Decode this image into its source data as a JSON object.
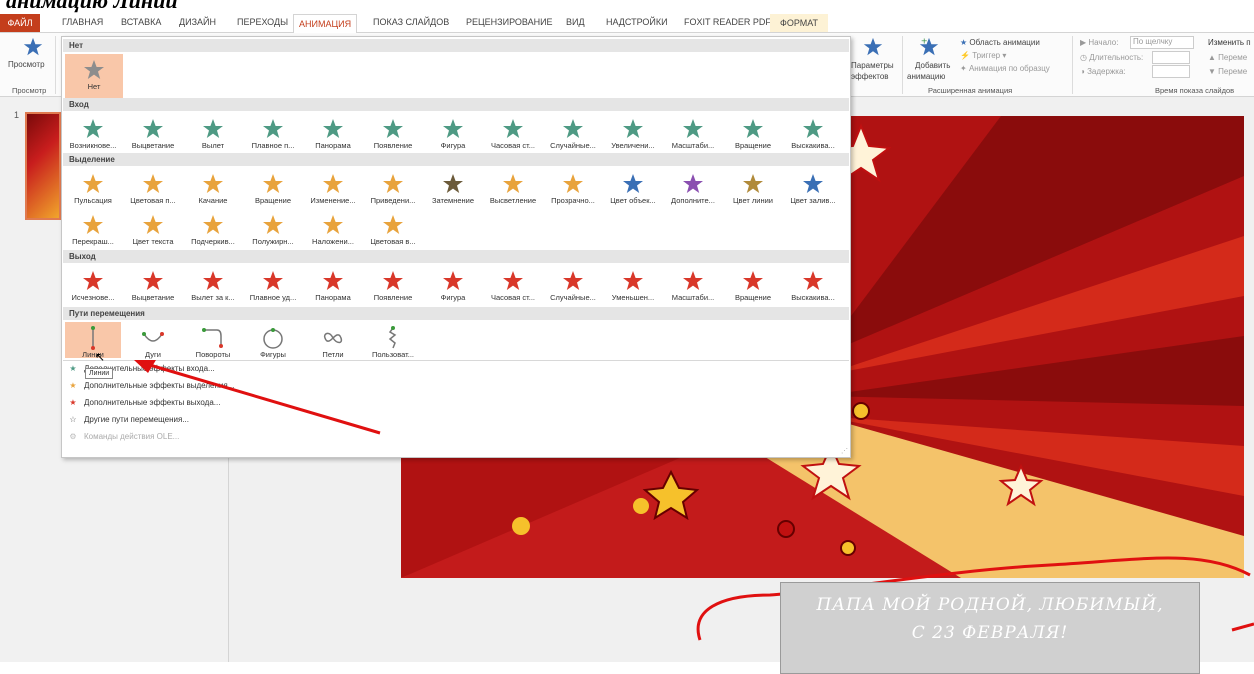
{
  "header_title": "анимацию Линии",
  "tabs": [
    "ФАЙЛ",
    "ГЛАВНАЯ",
    "ВСТАВКА",
    "ДИЗАЙН",
    "ПЕРЕХОДЫ",
    "АНИМАЦИЯ",
    "ПОКАЗ СЛАЙДОВ",
    "РЕЦЕНЗИРОВАНИЕ",
    "ВИД",
    "НАДСТРОЙКИ",
    "FOXIT READER PDF",
    "ФОРМАТ"
  ],
  "ribbon": {
    "preview_label": "Просмотр",
    "preview_group": "Просмотр",
    "effect_params": "Параметры",
    "effect_params2": "эффектов",
    "add_anim": "Добавить",
    "add_anim2": "анимацию",
    "anim_pane": "Область анимации",
    "trigger": "Триггер",
    "anim_painter": "Анимация по образцу",
    "adv_group": "Расширенная анимация",
    "start_label": "Начало:",
    "start_value": "По щелчку",
    "duration_label": "Длительность:",
    "delay_label": "Задержка:",
    "reorder": "Изменить п",
    "move_earlier": "Переме",
    "move_later": "Переме",
    "timing_group": "Время показа слайдов"
  },
  "gallery": {
    "none_header": "Нет",
    "none_item": "Нет",
    "entrance_header": "Вход",
    "entrance": [
      "Возникнове...",
      "Выцветание",
      "Вылет",
      "Плавное п...",
      "Панорама",
      "Появление",
      "Фигура",
      "Часовая ст...",
      "Случайные...",
      "Увеличени...",
      "Масштаби...",
      "Вращение",
      "Выскакива..."
    ],
    "emphasis_header": "Выделение",
    "emphasis1": [
      "Пульсация",
      "Цветовая п...",
      "Качание",
      "Вращение",
      "Изменение...",
      "Приведени...",
      "Затемнение",
      "Высветление",
      "Прозрачно...",
      "Цвет объек...",
      "Дополните...",
      "Цвет линии",
      "Цвет залив..."
    ],
    "emphasis2": [
      "Перекраш...",
      "Цвет текста",
      "Подчеркив...",
      "Полужирн...",
      "Наложени...",
      "Цветовая в..."
    ],
    "exit_header": "Выход",
    "exit": [
      "Исчезнове...",
      "Выцветание",
      "Вылет за к...",
      "Плавное уд...",
      "Панорама",
      "Появление",
      "Фигура",
      "Часовая ст...",
      "Случайные...",
      "Уменьшен...",
      "Масштаби...",
      "Вращение",
      "Выскакива..."
    ],
    "paths_header": "Пути перемещения",
    "paths": [
      "Линии",
      "Дуги",
      "Повороты",
      "Фигуры",
      "Петли",
      "Пользоват..."
    ],
    "more": [
      "Дополнительные эффекты входа...",
      "Дополнительные эффекты выделения...",
      "Дополнительные эффекты выхода...",
      "Другие пути перемещения...",
      "Команды действия OLE..."
    ],
    "tooltip": "Линии"
  },
  "slide_number": "1",
  "slide_text": [
    "ПАПА МОЙ РОДНОЙ, ЛЮБИМЫЙ,",
    "С 23 ФЕВРАЛЯ!"
  ],
  "colors": {
    "accent": "#c43e1c",
    "star_green": "#4e9a84",
    "star_gold": "#e8a33c",
    "star_red": "#d9382a",
    "hover": "#f9c7a9"
  }
}
